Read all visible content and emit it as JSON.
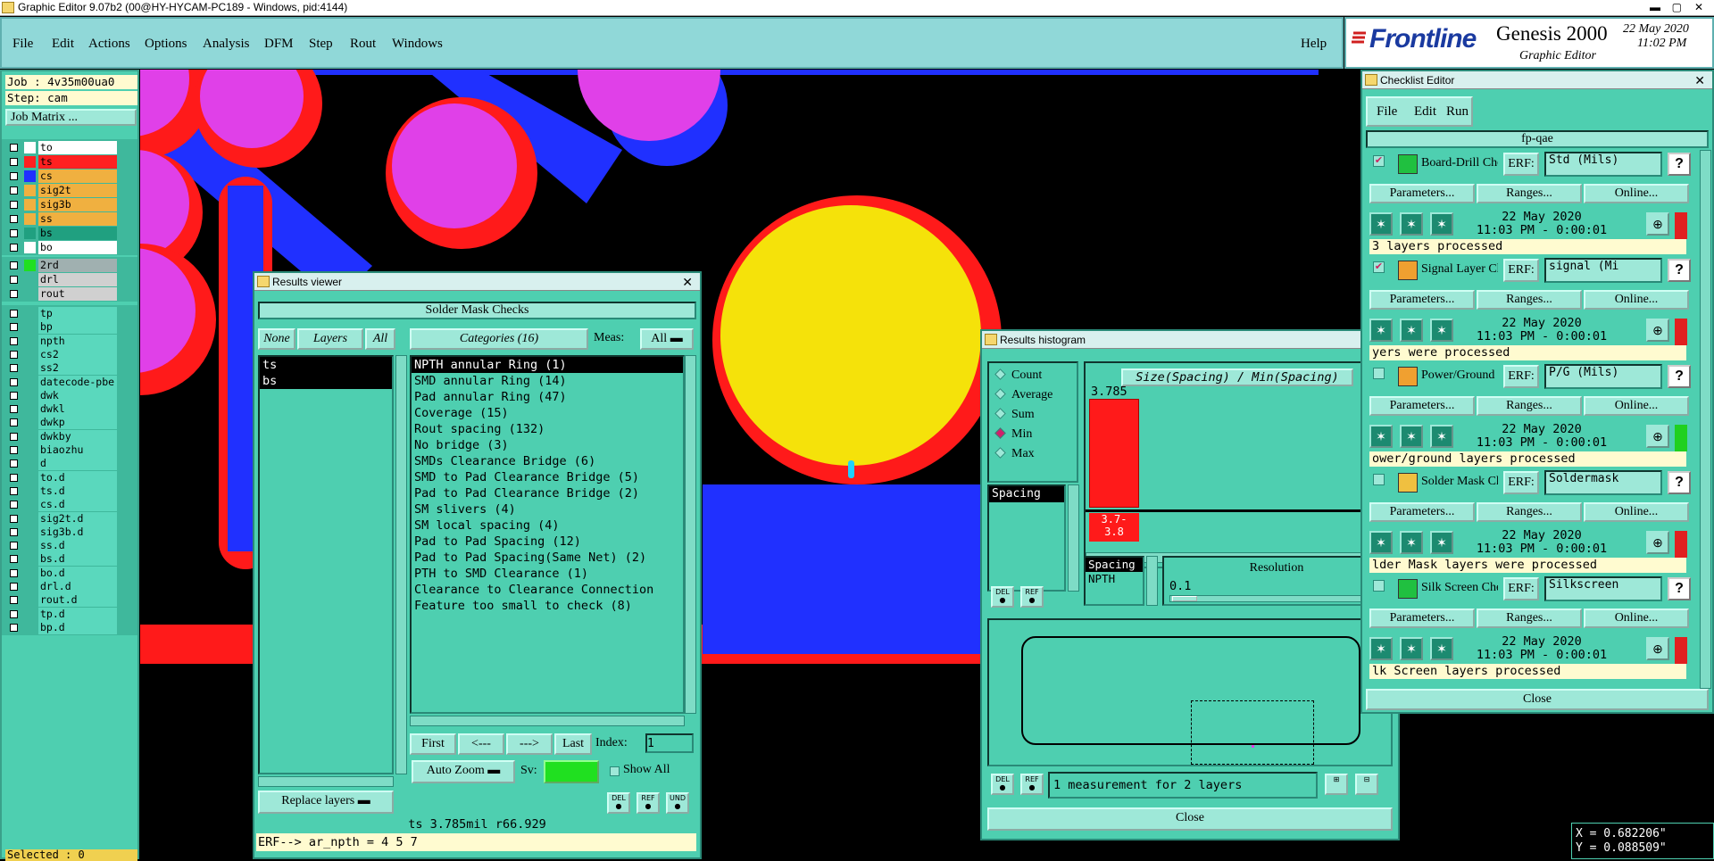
{
  "window_title": "Graphic Editor 9.07b2 (00@HY-HYCAM-PC189 - Windows, pid:4144)",
  "menu": [
    "File",
    "Edit",
    "Actions",
    "Options",
    "Analysis",
    "DFM",
    "Step",
    "Rout",
    "Windows"
  ],
  "help_label": "Help",
  "brand": {
    "logo": "Frontline",
    "product": "Genesis 2000",
    "subtitle": "Graphic Editor",
    "date": "22 May 2020",
    "time": "11:02 PM"
  },
  "sidebar": {
    "job": "Job : 4v35m00ua0",
    "step": "Step: cam",
    "job_matrix": "Job Matrix ...",
    "group1": [
      {
        "name": "to",
        "color": "#ffffff"
      },
      {
        "name": "ts",
        "color": "#ff2020"
      },
      {
        "name": "cs",
        "color": "#2030ff"
      },
      {
        "name": "sig2t",
        "color": "#f0b040"
      },
      {
        "name": "sig3b",
        "color": "#f0b040"
      },
      {
        "name": "ss",
        "color": "#f0b040"
      },
      {
        "name": "bs",
        "color": "#20a080"
      },
      {
        "name": "bo",
        "color": "#ffffff"
      }
    ],
    "group2": [
      {
        "name": "2rd",
        "color": "#20e020"
      },
      {
        "name": "drl",
        "color": ""
      },
      {
        "name": "rout",
        "color": ""
      }
    ],
    "group3": [
      "tp",
      "bp",
      "npth",
      "cs2",
      "ss2",
      "datecode-pbe",
      "dwk",
      "dwkl",
      "dwkp",
      "dwkby",
      "biaozhu",
      "d",
      "to.d",
      "ts.d",
      "cs.d",
      "sig2t.d",
      "sig3b.d",
      "ss.d",
      "bs.d",
      "bo.d",
      "drl.d",
      "rout.d",
      "tp.d",
      "bp.d"
    ],
    "selected": "Selected : 0"
  },
  "results_viewer": {
    "title": "Results viewer",
    "header": "Solder Mask Checks",
    "none_label": "None",
    "layers_label": "Layers",
    "all_label": "All",
    "categories_label": "Categories (16)",
    "meas_label": "Meas:",
    "meas_value": "All",
    "layers": [
      "ts",
      "bs"
    ],
    "categories": [
      "NPTH annular Ring (1)",
      "SMD annular Ring (14)",
      "Pad annular Ring (47)",
      "Coverage (15)",
      "Rout spacing (132)",
      "No bridge (3)",
      "SMDs Clearance Bridge (6)",
      "SMD to Pad Clearance Bridge (5)",
      "Pad to Pad Clearance Bridge (2)",
      "SM slivers (4)",
      "SM local spacing (4)",
      "Pad to Pad Spacing (12)",
      "Pad to Pad Spacing(Same Net) (2)",
      "PTH to SMD Clearance (1)",
      "Clearance to Clearance Connection",
      "Feature too small to check (8)"
    ],
    "first": "First",
    "prev": "<---",
    "next": "--->",
    "last": "Last",
    "index_label": "Index:",
    "index_value": "1",
    "auto_zoom": "Auto Zoom",
    "sv_label": "Sv:",
    "show_all": "Show All",
    "replace_layers": "Replace layers",
    "del": "DEL",
    "ref": "REF",
    "und": "UND",
    "status": "ts 3.785mil  r66.929",
    "erf": "ERF--> ar_npth = 4 5 7"
  },
  "histogram": {
    "title": "Results histogram",
    "modes": [
      "Count",
      "Average",
      "Sum",
      "Min",
      "Max"
    ],
    "selected_mode": "Min",
    "heading": "Size(Spacing) / Min(Spacing)",
    "bar_value": "3.785",
    "bin_label": "3.7-\n3.8",
    "list_item": "Spacing",
    "list2": [
      "Spacing",
      "NPTH"
    ],
    "resolution_label": "Resolution",
    "resolution_value": "0.1",
    "footer": "1 measurement for 2 layers",
    "close": "Close",
    "del": "DEL",
    "ref": "REF"
  },
  "checklist": {
    "title": "Checklist Editor",
    "menu": [
      "File",
      "Edit",
      "Run"
    ],
    "name": "fp-qae",
    "params_label": "Parameters...",
    "ranges_label": "Ranges...",
    "online_label": "Online...",
    "erf_label": "ERF:",
    "items": [
      {
        "name": "Board-Drill Che",
        "erf": "Std (Mils)",
        "date": "22 May 2020",
        "time": "11:03 PM - 0:00:01",
        "msg": "3 layers processed",
        "flag": "#e02020",
        "checked": true
      },
      {
        "name": "Signal Layer Ch",
        "erf": "signal (Mi",
        "date": "22 May 2020",
        "time": "11:03 PM - 0:00:01",
        "msg": "yers were processed",
        "flag": "#e02020",
        "checked": true
      },
      {
        "name": "Power/Ground C",
        "erf": "P/G (Mils)",
        "date": "22 May 2020",
        "time": "11:03 PM - 0:00:01",
        "msg": "ower/ground layers processed",
        "flag": "#20d020",
        "checked": false
      },
      {
        "name": "Solder Mask Che",
        "erf": "Soldermask",
        "date": "22 May 2020",
        "time": "11:03 PM - 0:00:01",
        "msg": "lder Mask layers were processed",
        "flag": "#e02020",
        "checked": false
      },
      {
        "name": "Silk Screen Che",
        "erf": "Silkscreen",
        "date": "22 May 2020",
        "time": "11:03 PM - 0:00:01",
        "msg": "lk Screen layers processed",
        "flag": "#e02020",
        "checked": false
      }
    ],
    "close": "Close"
  },
  "coords": {
    "x": "X = 0.682206\"",
    "y": "Y = 0.088509\""
  }
}
